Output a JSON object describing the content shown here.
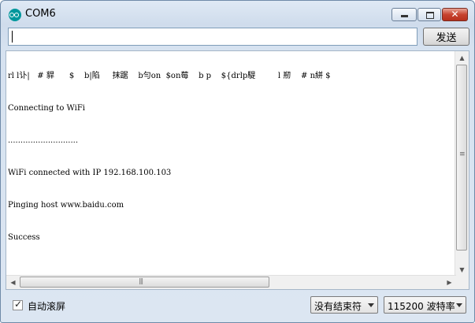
{
  "window": {
    "title": "COM6"
  },
  "toolbar": {
    "send_label": "发送",
    "input_value": ""
  },
  "serial_log": [
    "rl l讣|   # 貋      $    b|陷     抹踞    b勻on  $on莓    b p    ${drlp騠         l 剏    # n絣 $",
    "Connecting to WiFi",
    "............................",
    "WiFi connected with IP 192.168.100.103",
    "Pinging host www.baidu.com",
    "Success"
  ],
  "footer": {
    "autoscroll_label": "自动滚屏",
    "autoscroll_checked": true,
    "line_ending": "没有结束符",
    "baud_rate": "115200 波特率"
  },
  "icons": {
    "app": "arduino-icon",
    "minimize": "minimize-icon",
    "maximize": "maximize-icon",
    "close": "close-icon"
  },
  "colors": {
    "accent": "#00979c",
    "close_button": "#c7432f"
  }
}
